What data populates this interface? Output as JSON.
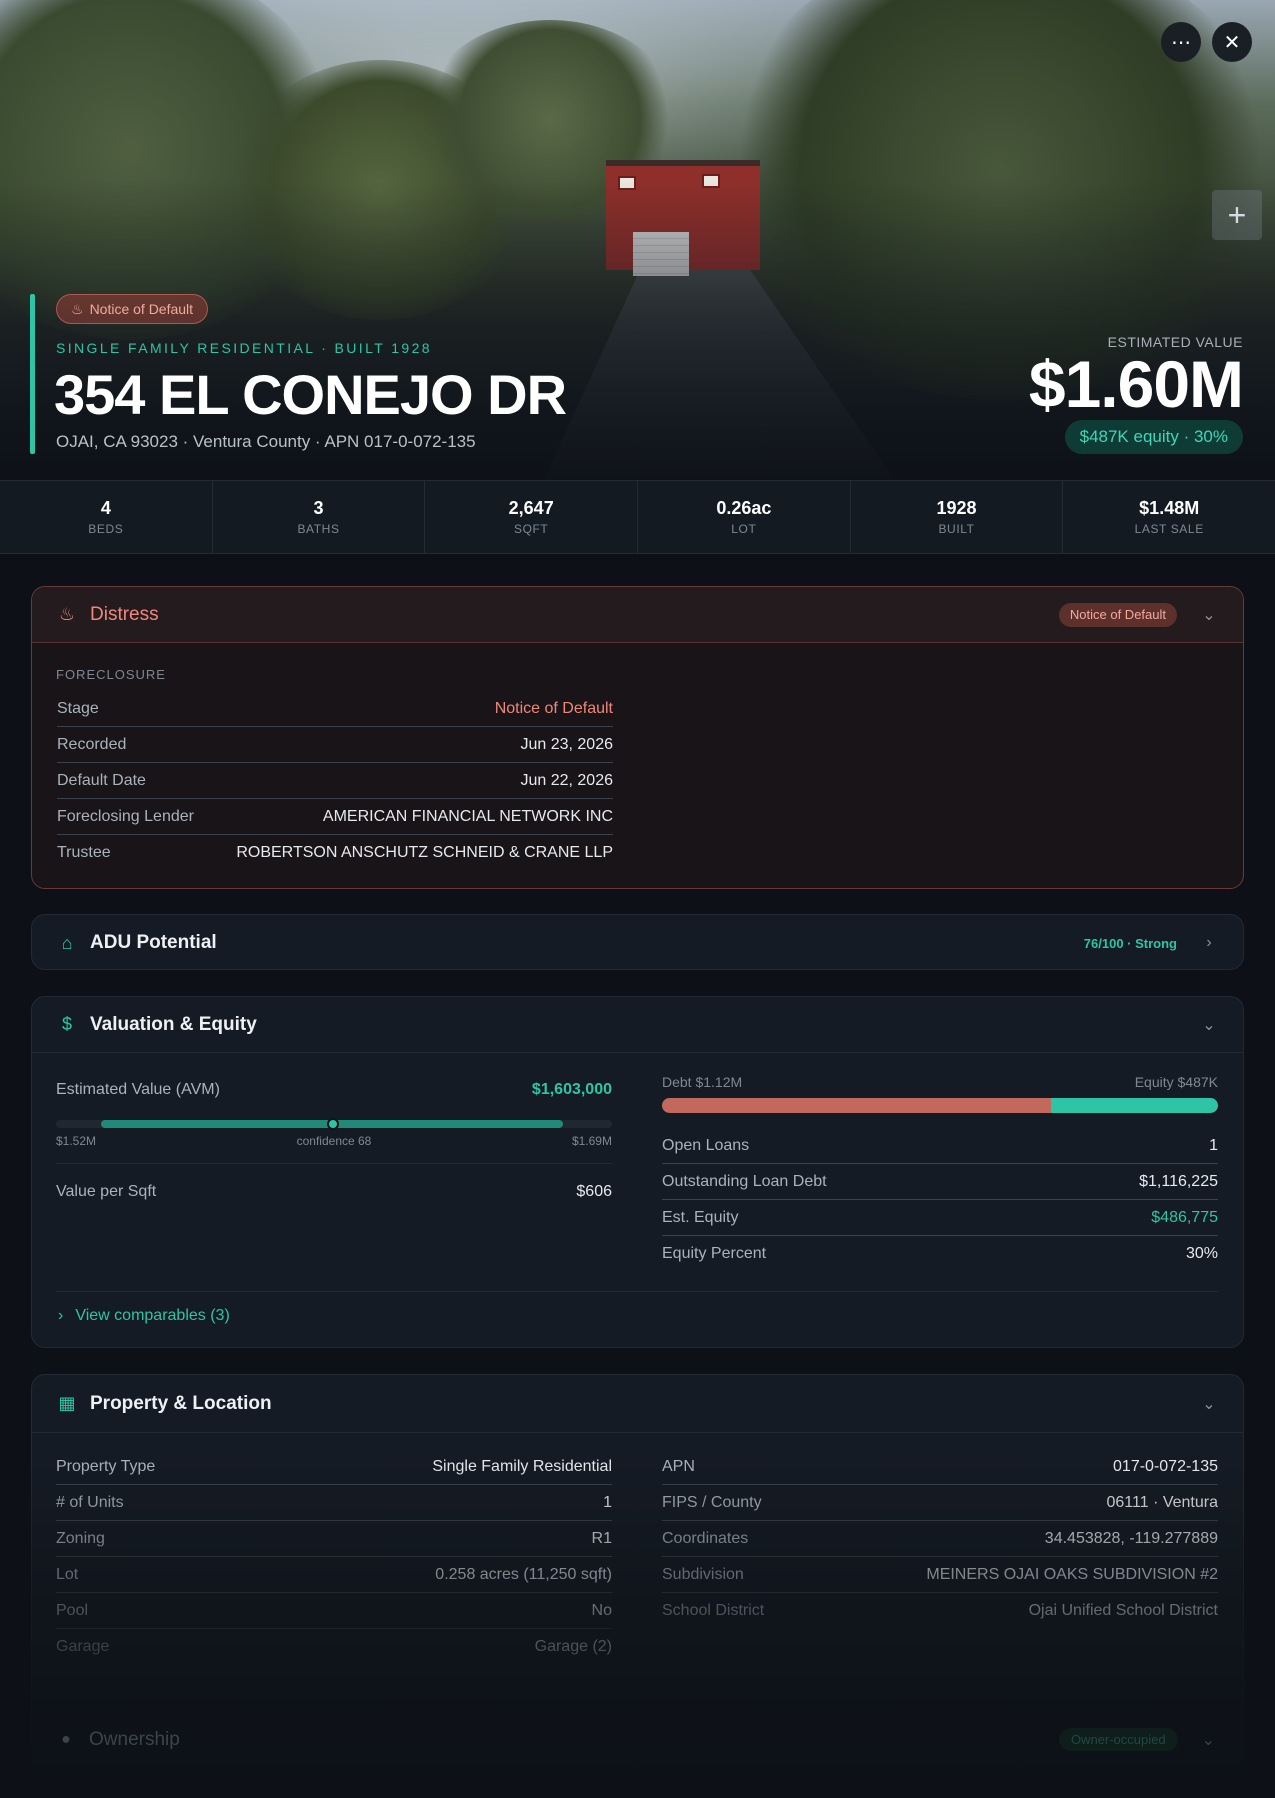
{
  "hero": {
    "distress_pill": "Notice of Default",
    "type_line": "SINGLE FAMILY RESIDENTIAL · BUILT 1928",
    "address": "354 EL CONEJO DR",
    "subaddress": "OJAI, CA 93023 · Ventura County · APN 017-0-072-135",
    "est_label": "ESTIMATED VALUE",
    "est_value": "$1.60M",
    "equity_pill": "$487K equity · 30%",
    "icons": {
      "more": "more-icon",
      "close": "close-icon",
      "zoom": "plus-icon"
    }
  },
  "stats": [
    {
      "value": "4",
      "label": "BEDS"
    },
    {
      "value": "3",
      "label": "BATHS"
    },
    {
      "value": "2,647",
      "label": "SQFT"
    },
    {
      "value": "0.26ac",
      "label": "LOT"
    },
    {
      "value": "1928",
      "label": "BUILT"
    },
    {
      "value": "$1.48M",
      "label": "LAST SALE"
    }
  ],
  "distress": {
    "title": "Distress",
    "badge": "Notice of Default",
    "section": "FORECLOSURE",
    "rows": [
      {
        "k": "Stage",
        "v": "Notice of Default"
      },
      {
        "k": "Recorded",
        "v": "Jun 23, 2026"
      },
      {
        "k": "Default Date",
        "v": "Jun 22, 2026"
      },
      {
        "k": "Foreclosing Lender",
        "v": "AMERICAN FINANCIAL NETWORK INC"
      },
      {
        "k": "Trustee",
        "v": "ROBERTSON ANSCHUTZ SCHNEID & CRANE LLP"
      }
    ]
  },
  "adu": {
    "title": "ADU Potential",
    "score": "76/100 · Strong"
  },
  "valuation": {
    "title": "Valuation & Equity",
    "avm_label": "Estimated Value (AVM)",
    "avm_value": "$1,603,000",
    "range_low": "$1.52M",
    "confidence": "confidence 68",
    "range_high": "$1.69M",
    "vps_label": "Value per Sqft",
    "vps_value": "$606",
    "debt_label": "Debt $1.12M",
    "equity_label": "Equity $487K",
    "debt_fraction": 0.7,
    "rows": [
      {
        "k": "Open Loans",
        "v": "1"
      },
      {
        "k": "Outstanding Loan Debt",
        "v": "$1,116,225"
      },
      {
        "k": "Est. Equity",
        "v": "$486,775"
      },
      {
        "k": "Equity Percent",
        "v": "30%"
      }
    ],
    "comparables_link": "View comparables (3)"
  },
  "property": {
    "title": "Property & Location",
    "left": [
      {
        "k": "Property Type",
        "v": "Single Family Residential"
      },
      {
        "k": "# of Units",
        "v": "1"
      },
      {
        "k": "Zoning",
        "v": "R1"
      },
      {
        "k": "Lot",
        "v": "0.258 acres (11,250 sqft)"
      },
      {
        "k": "Pool",
        "v": "No"
      },
      {
        "k": "Garage",
        "v": "Garage (2)"
      }
    ],
    "right": [
      {
        "k": "APN",
        "v": "017-0-072-135"
      },
      {
        "k": "FIPS / County",
        "v": "06111 · Ventura"
      },
      {
        "k": "Coordinates",
        "v": "34.453828, -119.277889"
      },
      {
        "k": "Subdivision",
        "v": "MEINERS OJAI OAKS SUBDIVISION #2"
      },
      {
        "k": "School District",
        "v": "Ojai Unified School District"
      }
    ]
  },
  "ownership": {
    "title": "Ownership",
    "badge": "Owner-occupied"
  },
  "colors": {
    "accent": "#2ec4a6",
    "danger": "#f0877a",
    "background": "#0d1117"
  }
}
